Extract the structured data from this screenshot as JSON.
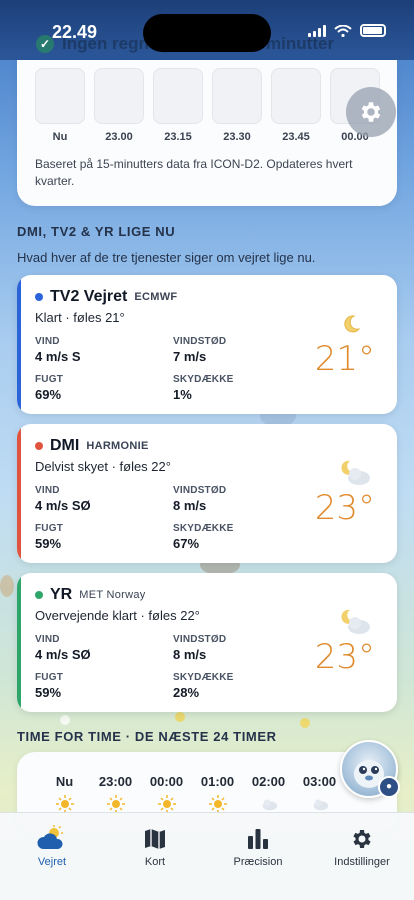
{
  "status_bar": {
    "time": "22.49"
  },
  "behind_header": {
    "title": "Ingen regn de næste 120 minutter"
  },
  "forecast_top": {
    "slot_labels": [
      "Nu",
      "23.00",
      "23.15",
      "23.30",
      "23.45",
      "00.00"
    ],
    "note": "Baseret på 15-minutters data fra ICON-D2. Opdateres hvert kvarter."
  },
  "comparison": {
    "title": "DMI, TV2 & YR LIGE NU",
    "subtitle": "Hvad hver af de tre tjenester siger om vejret lige nu."
  },
  "providers": [
    {
      "name": "TV2 Vejret",
      "model": "ECMWF",
      "accent": "#2b63d9",
      "condition": "Klart · føles 21°",
      "wind_label": "VIND",
      "wind": "4 m/s S",
      "gust_label": "VINDSTØD",
      "gust": "7 m/s",
      "humidity_label": "FUGT",
      "humidity": "69%",
      "cloud_label": "SKYDÆKKE",
      "cloud": "1%",
      "temp": "21°",
      "icon": "moon-icon"
    },
    {
      "name": "DMI",
      "model": "HARMONIE",
      "accent": "#e0543f",
      "condition": "Delvist skyet · føles 22°",
      "wind_label": "VIND",
      "wind": "4 m/s SØ",
      "gust_label": "VINDSTØD",
      "gust": "8 m/s",
      "humidity_label": "FUGT",
      "humidity": "59%",
      "cloud_label": "SKYDÆKKE",
      "cloud": "67%",
      "temp": "23°",
      "icon": "moon-cloud-icon"
    },
    {
      "name": "YR",
      "model": "MET Norway",
      "accent": "#2ea66a",
      "condition": "Overvejende klart · føles 22°",
      "wind_label": "VIND",
      "wind": "4 m/s SØ",
      "gust_label": "VINDSTØD",
      "gust": "8 m/s",
      "humidity_label": "FUGT",
      "humidity": "59%",
      "cloud_label": "SKYDÆKKE",
      "cloud": "28%",
      "temp": "23°",
      "icon": "moon-cloud-icon"
    }
  ],
  "hourly": {
    "title": "TIME FOR TIME · DE NÆSTE 24 TIMER",
    "hours": [
      {
        "label": "Nu",
        "icon": "sun-icon"
      },
      {
        "label": "23:00",
        "icon": "sun-icon"
      },
      {
        "label": "00:00",
        "icon": "sun-icon"
      },
      {
        "label": "01:00",
        "icon": "sun-icon"
      },
      {
        "label": "02:00",
        "icon": "cloud-icon"
      },
      {
        "label": "03:00",
        "icon": "cloud-icon"
      }
    ]
  },
  "tabs": [
    {
      "label": "Vejret",
      "icon": "weather-icon",
      "active": true
    },
    {
      "label": "Kort",
      "icon": "map-icon",
      "active": false
    },
    {
      "label": "Præcision",
      "icon": "chart-icon",
      "active": false
    },
    {
      "label": "Indstillinger",
      "icon": "gear-icon",
      "active": false
    }
  ],
  "colors": {
    "temp": "#e08a2e",
    "active_tab": "#1f5fae"
  }
}
